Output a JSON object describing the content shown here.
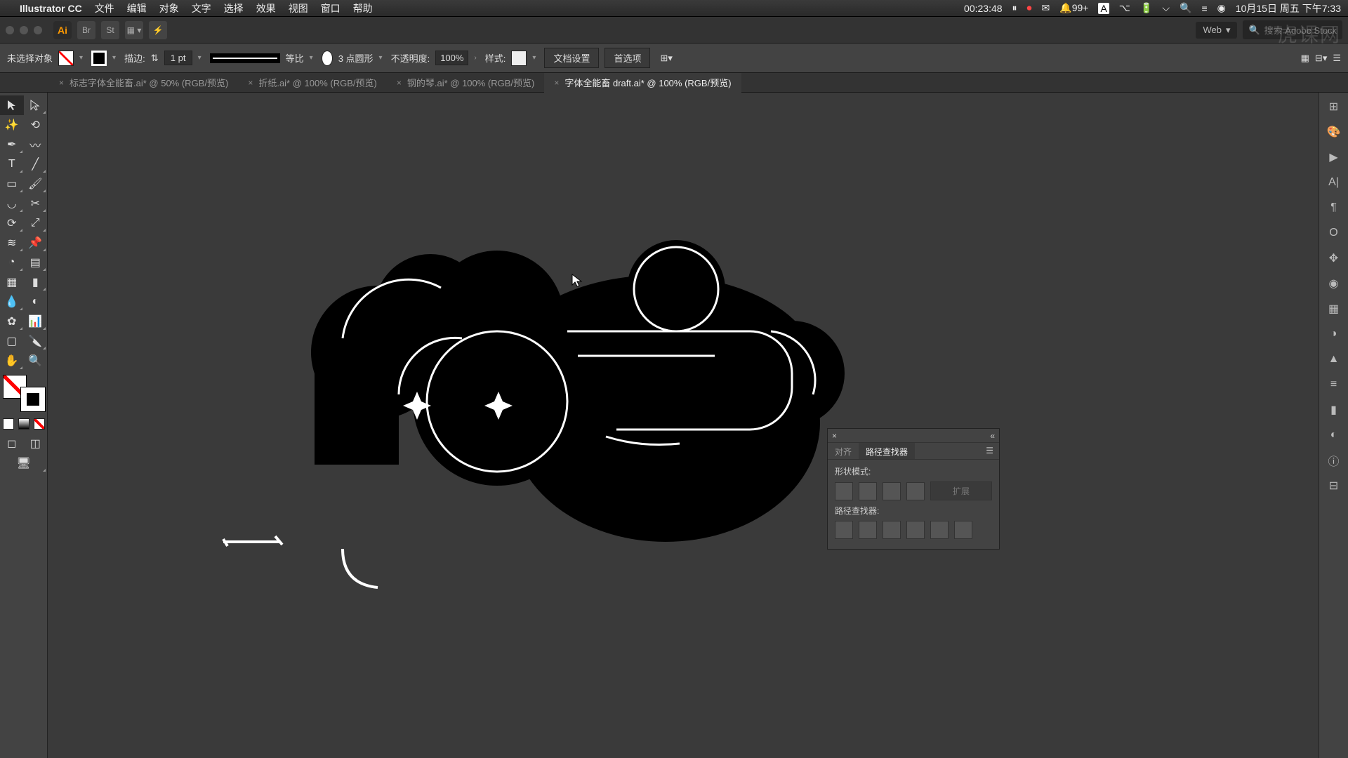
{
  "menubar": {
    "app": "Illustrator CC",
    "items": [
      "文件",
      "编辑",
      "对象",
      "文字",
      "选择",
      "效果",
      "视图",
      "窗口",
      "帮助"
    ],
    "timer": "00:23:48",
    "notif": "99+",
    "date": "10月15日 周五 下午7:33"
  },
  "appbar": {
    "docprofile": "Web",
    "search_placeholder": "搜索 Adobe Stock"
  },
  "ctrl": {
    "selection": "未选择对象",
    "stroke_label": "描边:",
    "stroke_val": "1 pt",
    "profile_label": "等比",
    "brush_label": "3 点圆形",
    "opacity_label": "不透明度:",
    "opacity_val": "100%",
    "style_label": "样式:",
    "btn_docsetup": "文档设置",
    "btn_prefs": "首选项"
  },
  "tabs": [
    {
      "label": "标志字体全能畜.ai* @ 50% (RGB/预览)"
    },
    {
      "label": "折纸.ai* @ 100% (RGB/预览)"
    },
    {
      "label": "钢的琴.ai* @ 100% (RGB/预览)"
    },
    {
      "label": "字体全能畜 draft.ai* @ 100% (RGB/预览)",
      "active": true
    }
  ],
  "pathfinder": {
    "tab_align": "对齐",
    "tab_pathfinder": "路径查找器",
    "shape_modes": "形状模式:",
    "pathfinders": "路径查找器:",
    "expand": "扩展"
  },
  "watermark": "虎课网"
}
